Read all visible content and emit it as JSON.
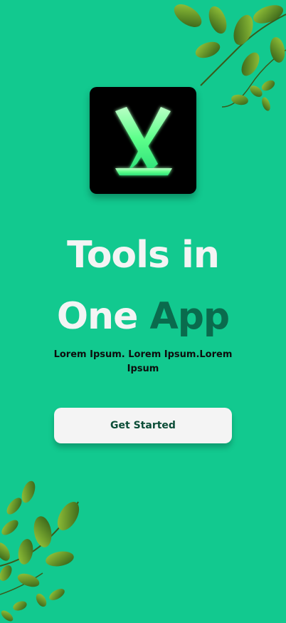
{
  "app": {
    "headline_line1": "Tools in",
    "headline_line2_part1": "One",
    "headline_line2_accent": "App",
    "subtitle": "Lorem Ipsum. Lorem Ipsum.Lorem Ipsum",
    "cta_label": "Get Started"
  },
  "colors": {
    "background": "#12c98f",
    "accent_text": "#0a6b4d",
    "button_bg": "#f4f4f4",
    "logo_glow": "#7dff9a"
  },
  "icons": {
    "logo": "app-logo-icon",
    "decor_top": "leaves-decoration-top",
    "decor_bottom": "leaves-decoration-bottom"
  }
}
